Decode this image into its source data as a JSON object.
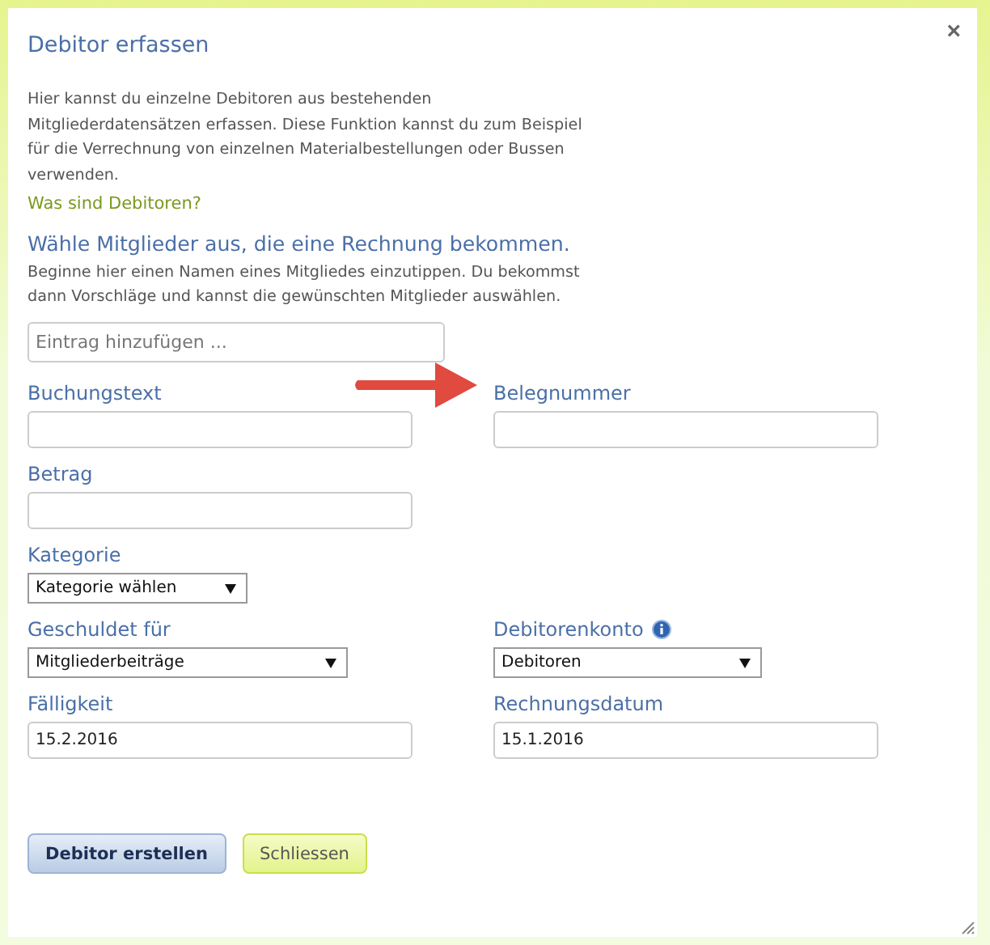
{
  "dialog": {
    "title": "Debitor erfassen",
    "close": "×"
  },
  "intro": "Hier kannst du einzelne Debitoren aus bestehenden Mitgliederdatensätzen erfassen. Diese Funktion kannst du zum Beispiel für die Verrechnung von einzelnen Materialbestellungen oder Bussen verwenden.",
  "help_link": "Was sind Debitoren?",
  "members": {
    "heading": "Wähle Mitglieder aus, die eine Rechnung bekommen.",
    "hint": "Beginne hier einen Namen eines Mitgliedes einzutippen. Du bekommst dann Vorschläge und kannst die gewünschten Mitglieder auswählen.",
    "placeholder": "Eintrag hinzufügen ..."
  },
  "rows": [
    {
      "fields": [
        {
          "kind": "text",
          "label": "Buchungstext"
        },
        {
          "kind": "text",
          "label": "Belegnummer"
        }
      ]
    },
    {
      "fields": [
        {
          "kind": "text",
          "label": "Betrag"
        }
      ]
    },
    {
      "fields": [
        {
          "kind": "short_select",
          "label": "Kategorie",
          "value": "Kategorie wählen"
        }
      ]
    },
    {
      "fields": [
        {
          "kind": "select",
          "label": "Geschuldet für",
          "value": "Mitgliederbeiträge"
        },
        {
          "kind": "select",
          "label": "Debitorenkonto",
          "value": "Debitoren",
          "info": true
        }
      ]
    },
    {
      "fields": [
        {
          "kind": "text",
          "label": "Fälligkeit",
          "value": "15.2.2016"
        },
        {
          "kind": "text",
          "label": "Rechnungsdatum",
          "value": "15.1.2016"
        }
      ]
    }
  ],
  "buttons": [
    {
      "kind": "primary",
      "label": "Debitor erstellen"
    },
    {
      "kind": "secondary",
      "label": "Schliessen"
    }
  ]
}
